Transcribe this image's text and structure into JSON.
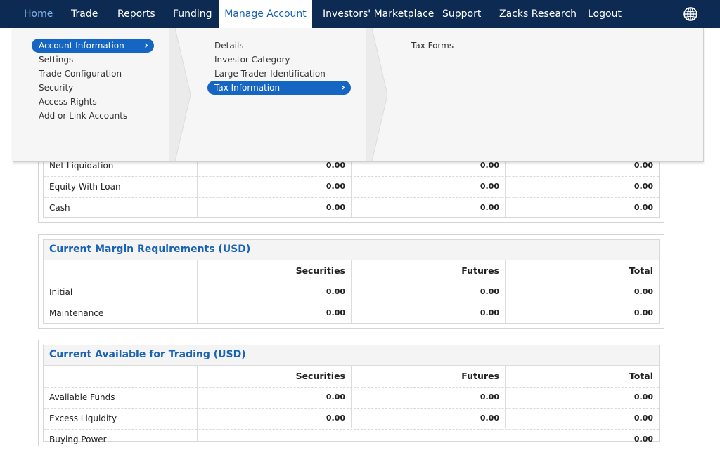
{
  "nav": {
    "items": [
      "Home",
      "Trade",
      "Reports",
      "Funding",
      "Manage Account",
      "Investors' Marketplace",
      "Support",
      "Zacks Research",
      "Logout"
    ]
  },
  "menu": {
    "col1": [
      "Account Information",
      "Settings",
      "Trade Configuration",
      "Security",
      "Access Rights",
      "Add or Link Accounts"
    ],
    "col2": [
      "Details",
      "Investor Category",
      "Large Trader Identification",
      "Tax Information"
    ],
    "col3": [
      "Tax Forms"
    ]
  },
  "balances": {
    "rows": [
      {
        "label": "Net Liquidation",
        "securities": "0.00",
        "futures": "0.00",
        "total": "0.00"
      },
      {
        "label": "Equity With Loan",
        "securities": "0.00",
        "futures": "0.00",
        "total": "0.00"
      },
      {
        "label": "Cash",
        "securities": "0.00",
        "futures": "0.00",
        "total": "0.00"
      }
    ]
  },
  "margin": {
    "title": "Current Margin Requirements (USD)",
    "headers": [
      "Securities",
      "Futures",
      "Total"
    ],
    "rows": [
      {
        "label": "Initial",
        "securities": "0.00",
        "futures": "0.00",
        "total": "0.00"
      },
      {
        "label": "Maintenance",
        "securities": "0.00",
        "futures": "0.00",
        "total": "0.00"
      }
    ]
  },
  "available": {
    "title": "Current Available for Trading (USD)",
    "headers": [
      "Securities",
      "Futures",
      "Total"
    ],
    "rows": [
      {
        "label": "Available Funds",
        "securities": "0.00",
        "futures": "0.00",
        "total": "0.00"
      },
      {
        "label": "Excess Liquidity",
        "securities": "0.00",
        "futures": "0.00",
        "total": "0.00"
      },
      {
        "label": "Buying Power",
        "securities": "",
        "futures": "",
        "total": "0.00"
      }
    ]
  }
}
